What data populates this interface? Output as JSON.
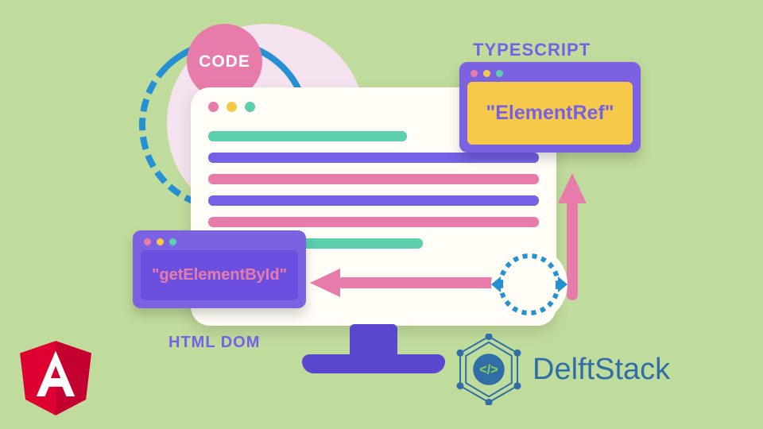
{
  "badge": {
    "code": "CODE"
  },
  "labels": {
    "typescript": "TYPESCRIPT",
    "htmldom": "HTML DOM"
  },
  "windows": {
    "ts": {
      "text": "\"ElementRef\""
    },
    "dom": {
      "text": "\"getElementById\""
    }
  },
  "brand": {
    "name": "DelftStack"
  },
  "colors": {
    "bg": "#c0dc9c",
    "purple": "#7461e6",
    "pink": "#e77cab",
    "teal": "#5bcfae",
    "yellow": "#f7c94a",
    "blue": "#2590d3",
    "angular": "#c3002f"
  }
}
